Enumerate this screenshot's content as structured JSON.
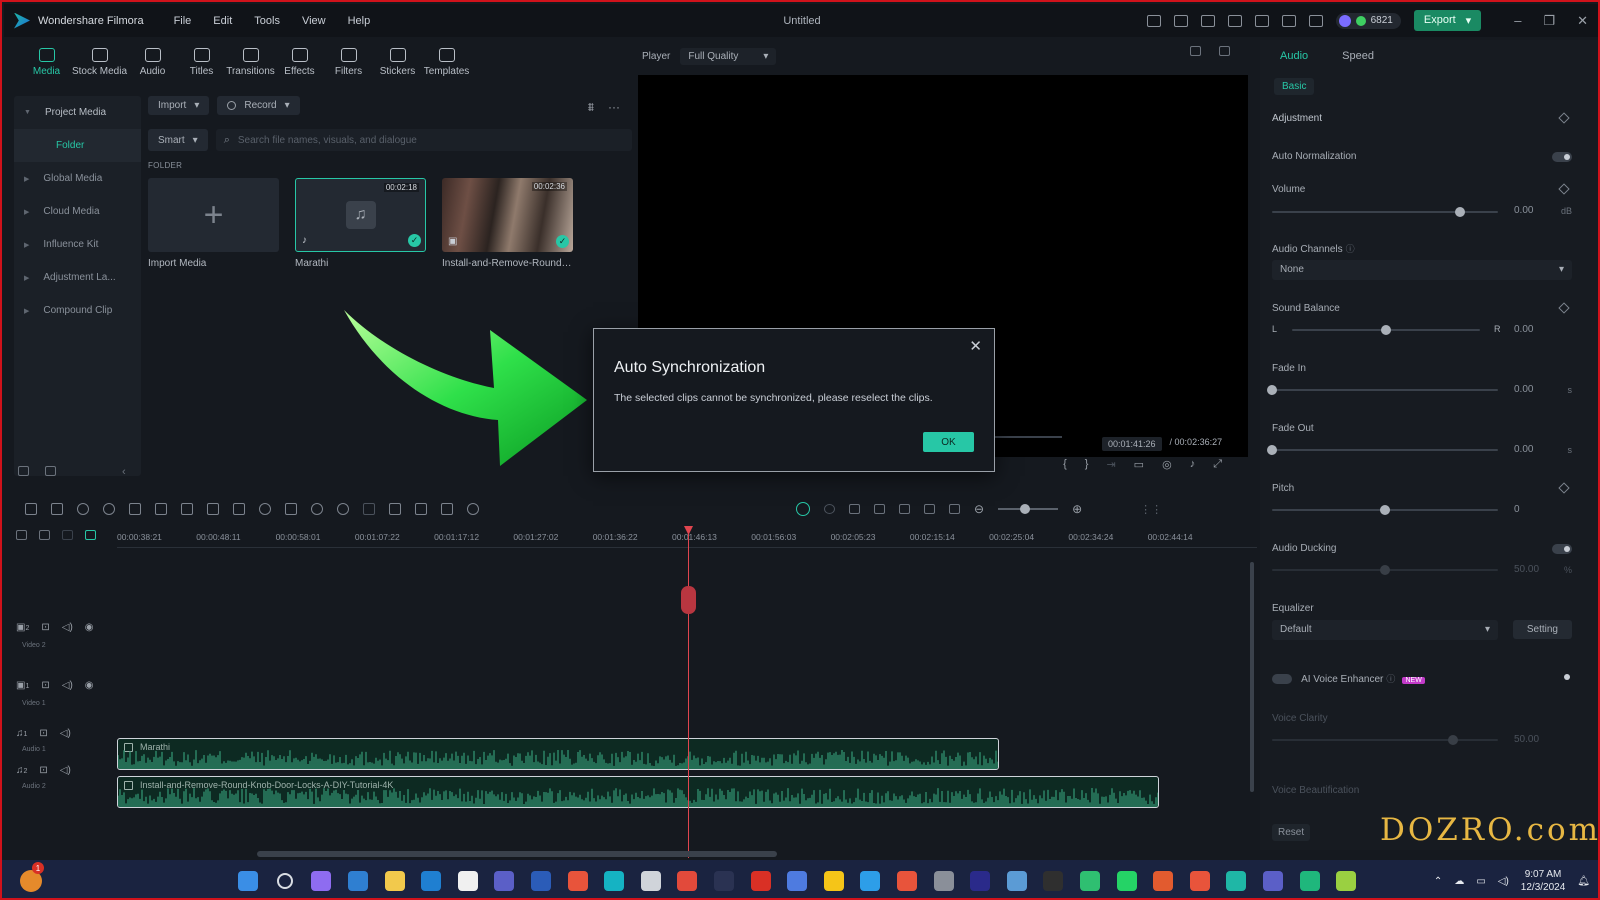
{
  "titlebar": {
    "app_name": "Wondershare Filmora",
    "menu": [
      "File",
      "Edit",
      "Tools",
      "View",
      "Help"
    ],
    "document_title": "Untitled",
    "credits": "6821",
    "export_label": "Export"
  },
  "tooltabs": [
    "Media",
    "Stock Media",
    "Audio",
    "Titles",
    "Transitions",
    "Effects",
    "Filters",
    "Stickers",
    "Templates"
  ],
  "leftnav": {
    "project_media": "Project Media",
    "folder": "Folder",
    "items": [
      "Global Media",
      "Cloud Media",
      "Influence Kit",
      "Adjustment La...",
      "Compound Clip"
    ]
  },
  "media": {
    "import_label": "Import",
    "record_label": "Record",
    "smart_label": "Smart",
    "search_placeholder": "Search file names, visuals, and dialogue",
    "folder_heading": "FOLDER",
    "tiles": [
      {
        "name": "Import Media",
        "duration": ""
      },
      {
        "name": "Marathi",
        "duration": "00:02:18"
      },
      {
        "name": "Install-and-Remove-Round-...",
        "duration": "00:02:36"
      }
    ]
  },
  "player": {
    "label": "Player",
    "quality": "Full Quality",
    "current_time": "00:01:41:26",
    "total_time": "/ 00:02:36:27"
  },
  "dialog": {
    "title": "Auto Synchronization",
    "message": "The selected clips cannot be synchronized, please reselect the clips.",
    "ok_label": "OK"
  },
  "rpanel": {
    "tabs": [
      "Audio",
      "Speed"
    ],
    "basic": "Basic",
    "adjustment": "Adjustment",
    "auto_normalization": "Auto Normalization",
    "volume": {
      "label": "Volume",
      "value": "0.00",
      "unit": "dB",
      "level": 0.83
    },
    "audio_channels": {
      "label": "Audio Channels",
      "value": "None"
    },
    "sound_balance": {
      "label": "Sound Balance",
      "left": "L",
      "right": "R",
      "value": "0.00",
      "level": 0.5
    },
    "fade_in": {
      "label": "Fade In",
      "value": "0.00",
      "unit": "s",
      "level": 0
    },
    "fade_out": {
      "label": "Fade Out",
      "value": "0.00",
      "unit": "s",
      "level": 0
    },
    "pitch": {
      "label": "Pitch",
      "value": "0",
      "level": 0.5
    },
    "audio_ducking": {
      "label": "Audio Ducking",
      "value": "50.00",
      "unit": "%",
      "level": 0.5
    },
    "equalizer": {
      "label": "Equalizer",
      "value": "Default",
      "setting_label": "Setting"
    },
    "ai_voice": {
      "label": "AI Voice Enhancer",
      "badge": "NEW"
    },
    "voice_clarity": {
      "label": "Voice Clarity",
      "value": "50.00",
      "level": 0.8
    },
    "voice_beautification": "Voice Beautification",
    "reset_label": "Reset"
  },
  "timeline": {
    "ticks": [
      "00:00:38:21",
      "00:00:48:11",
      "00:00:58:01",
      "00:01:07:22",
      "00:01:17:12",
      "00:01:27:02",
      "00:01:36:22",
      "00:01:46:13",
      "00:01:56:03",
      "00:02:05:23",
      "00:02:15:14",
      "00:02:25:04",
      "00:02:34:24",
      "00:02:44:14"
    ],
    "tracks": [
      {
        "num": "2",
        "name": "Video 2"
      },
      {
        "num": "1",
        "name": "Video 1"
      },
      {
        "num": "1",
        "name": "Audio 1"
      },
      {
        "num": "2",
        "name": "Audio 2"
      }
    ],
    "clips": [
      {
        "title": "Marathi"
      },
      {
        "title": "Install-and-Remove-Round-Knob-Door-Locks-A-DIY-Tutorial-4K"
      }
    ]
  },
  "watermark": "DOZRO.com",
  "taskbar": {
    "time": "9:07 AM",
    "date": "12/3/2024",
    "notification_count": "1",
    "app_colors": [
      "#3a8ee6",
      "#d9dde3",
      "#8e6cf0",
      "#2f7fd1",
      "#f2c94c",
      "#1f7fd1",
      "#f0f0f0",
      "#5b5fc7",
      "#2b5cb8",
      "#e8543b",
      "#15b3c3",
      "#d0d4da",
      "#e24a3b",
      "#2a3252",
      "#d93025",
      "#4e7be0",
      "#f5c518",
      "#2d9ee8",
      "#e8543b",
      "#8a8f99",
      "#2a2a8a",
      "#5b9bd5",
      "#2f2f2f",
      "#2fbf71",
      "#25d366",
      "#e25b2f",
      "#e8543b",
      "#1fb7a6",
      "#5b5fc7",
      "#1fb77c",
      "#9ad041"
    ]
  }
}
